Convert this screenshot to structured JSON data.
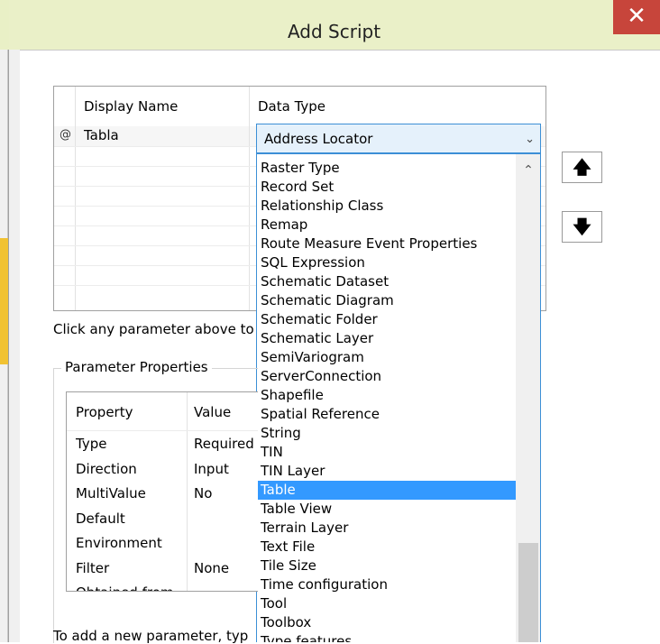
{
  "window": {
    "title": "Add Script",
    "close_glyph": "✕"
  },
  "param_grid": {
    "headers": {
      "display_name": "Display Name",
      "data_type": "Data Type"
    },
    "row": {
      "marker": "@",
      "display_name": "Tabla"
    }
  },
  "data_type_select": {
    "value": "Address Locator",
    "options": [
      "Raster Type",
      "Record Set",
      "Relationship Class",
      "Remap",
      "Route Measure Event Properties",
      "SQL Expression",
      "Schematic Dataset",
      "Schematic Diagram",
      "Schematic Folder",
      "Schematic Layer",
      "SemiVariogram",
      "ServerConnection",
      "Shapefile",
      "Spatial Reference",
      "String",
      "TIN",
      "TIN Layer",
      "Table",
      "Table View",
      "Terrain Layer",
      "Text File",
      "Tile Size",
      "Time configuration",
      "Tool",
      "Toolbox",
      "Type features"
    ],
    "selected": "Table"
  },
  "move_buttons": {
    "up_glyph": "🡅",
    "down_glyph": "🡇"
  },
  "hint": "Click any parameter above to",
  "parameter_properties": {
    "group_label": "Parameter Properties",
    "headers": {
      "property": "Property",
      "value": "Value"
    },
    "rows": [
      {
        "property": "Type",
        "value": "Required"
      },
      {
        "property": "Direction",
        "value": "Input"
      },
      {
        "property": "MultiValue",
        "value": "No"
      },
      {
        "property": "Default",
        "value": ""
      },
      {
        "property": "Environment",
        "value": ""
      },
      {
        "property": "Filter",
        "value": "None"
      },
      {
        "property": "Obtained from",
        "value": ""
      }
    ]
  },
  "footer": "To add a new parameter, typ"
}
